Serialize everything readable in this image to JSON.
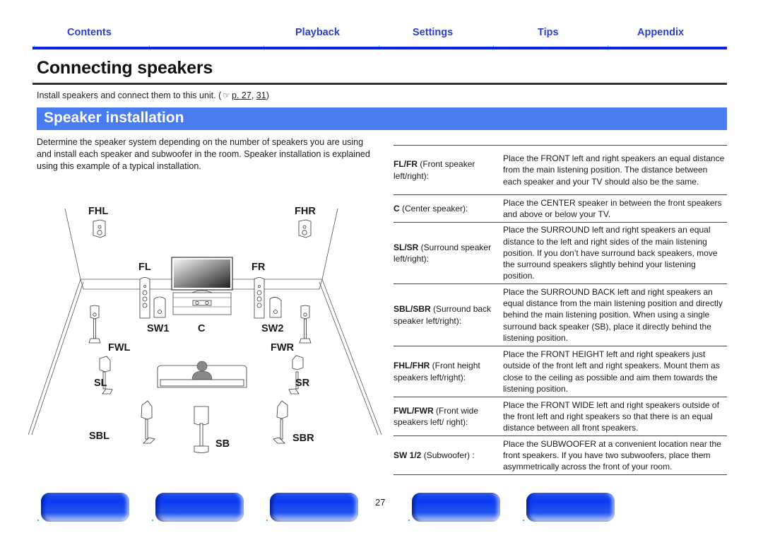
{
  "nav": {
    "tabs": [
      "Contents",
      "Playback",
      "Settings",
      "Tips",
      "Appendix"
    ]
  },
  "page": {
    "title": "Connecting speakers",
    "intro_text": "Install speakers and connect them to this unit. (",
    "ref_icon": "hand-pointer-icon",
    "ref_link1": "p. 27",
    "ref_sep": ", ",
    "ref_link2": "31",
    "ref_close": ")",
    "number": "27"
  },
  "section": {
    "title": "Speaker installation",
    "description": "Determine the speaker system depending on the number of speakers you are using and install each speaker and subwoofer in the room. Speaker installation is explained using this example of a typical installation."
  },
  "diagram": {
    "labels": {
      "FHL": "FHL",
      "FHR": "FHR",
      "FL": "FL",
      "FR": "FR",
      "SW1": "SW1",
      "C": "C",
      "SW2": "SW2",
      "FWL": "FWL",
      "FWR": "FWR",
      "SL": "SL",
      "SR": "SR",
      "SBL": "SBL",
      "SB": "SB",
      "SBR": "SBR"
    }
  },
  "speakers": [
    {
      "code": "FL/FR",
      "name_rest": " (Front speaker left/right):",
      "text": "Place the FRONT left and right speakers an equal distance from the main listening position. The distance between each speaker and your TV should also be the same."
    },
    {
      "code": "C",
      "name_rest": " (Center speaker):",
      "text": "Place the CENTER speaker in between the front speakers and above or below your TV."
    },
    {
      "code": "SL/SR",
      "name_rest": " (Surround speaker left/right):",
      "text": "Place the SURROUND left and right speakers an equal distance to the left and right sides of the main listening position. If you don’t have surround back speakers, move the surround speakers slightly behind your listening position."
    },
    {
      "code": "SBL/SBR",
      "name_rest": " (Surround back speaker left/right):",
      "text": "Place the SURROUND BACK left and right speakers an equal distance from the main listening position and directly behind the main listening position. When using a single surround back speaker (SB), place it directly behind the listening position."
    },
    {
      "code": "FHL/FHR",
      "name_rest": " (Front height speakers left/right):",
      "text": "Place the FRONT HEIGHT left and right speakers just outside of the front left and right speakers. Mount them as close to the ceiling as possible and aim them towards the listening position."
    },
    {
      "code": "FWL/FWR",
      "name_rest": " (Front wide speakers left/ right):",
      "text": "Place the FRONT WIDE left and right speakers outside of the front left and right speakers so that there is an equal distance between all front speakers."
    },
    {
      "code": "SW 1/2",
      "name_rest": " (Subwoofer) :",
      "text": "Place the SUBWOOFER at a convenient location near the front speakers. If you have two subwoofers, place them asymmetrically across the front of your room."
    }
  ],
  "colors": {
    "nav_text": "#2a3fd0",
    "nav_bar": "#0a22e6",
    "section_bar": "#4a7cf0",
    "button_blue": "#0b3cf2"
  }
}
